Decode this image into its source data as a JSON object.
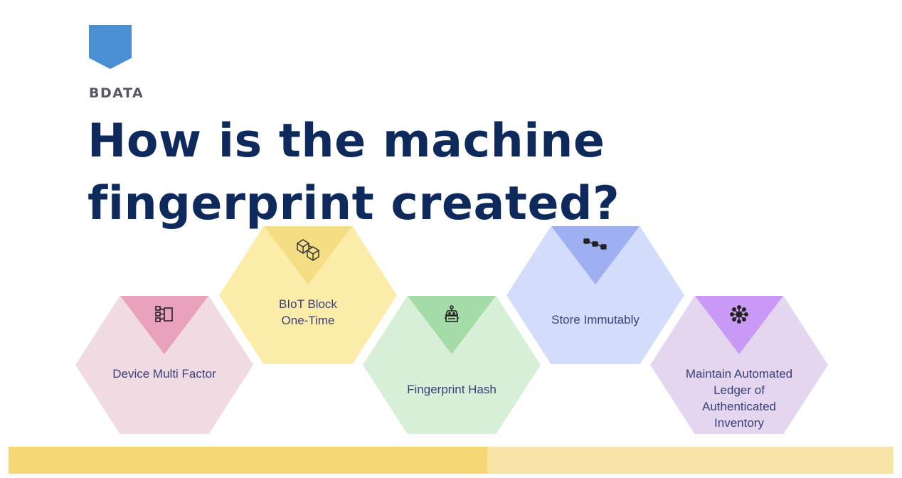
{
  "brand": "BDATA",
  "title_lines": [
    "How is the machine",
    "fingerprint created?"
  ],
  "steps": [
    {
      "label": "Device Multi Factor",
      "icon": "flowchart-icon",
      "hex_color": "#f0dbe3",
      "tri_color": "#e9a1bc"
    },
    {
      "label": "BIoT Block One-Time",
      "icon": "blocks-icon",
      "hex_color": "#fbeda9",
      "tri_color": "#f5dd84"
    },
    {
      "label": "Fingerprint Hash",
      "icon": "robot-icon",
      "hex_color": "#d7efd6",
      "tri_color": "#a5dba7"
    },
    {
      "label": "Store Immutably",
      "icon": "chain-icon",
      "hex_color": "#d3dcfa",
      "tri_color": "#9fb0f2"
    },
    {
      "label": "Maintain Automated Ledger of Authenticated Inventory",
      "icon": "network-icon",
      "hex_color": "#e4d6ee",
      "tri_color": "#c89af5"
    }
  ],
  "colors": {
    "title": "#0e2a5c",
    "bookmark": "#4a8fd3",
    "footer_left": "#f6d778",
    "footer_right": "#f8e4a6"
  }
}
